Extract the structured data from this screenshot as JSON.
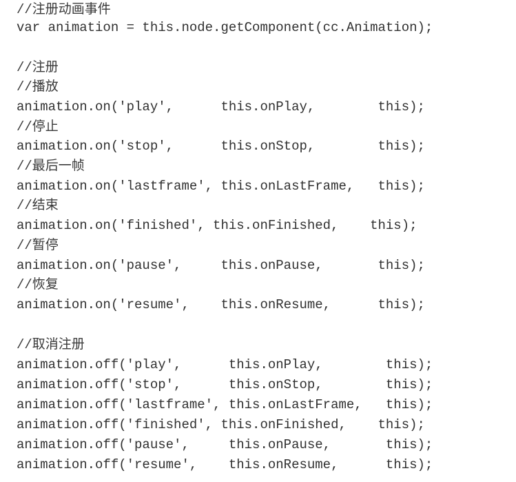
{
  "code": {
    "lines": [
      "//注册动画事件",
      "var animation = this.node.getComponent(cc.Animation);",
      "",
      "//注册",
      "//播放",
      "animation.on('play',      this.onPlay,        this);",
      "//停止",
      "animation.on('stop',      this.onStop,        this);",
      "//最后一帧",
      "animation.on('lastframe', this.onLastFrame,   this);",
      "//结束",
      "animation.on('finished', this.onFinished,    this);",
      "//暂停",
      "animation.on('pause',     this.onPause,       this);",
      "//恢复",
      "animation.on('resume',    this.onResume,      this);",
      "",
      "//取消注册",
      "animation.off('play',      this.onPlay,        this);",
      "animation.off('stop',      this.onStop,        this);",
      "animation.off('lastframe', this.onLastFrame,   this);",
      "animation.off('finished', this.onFinished,    this);",
      "animation.off('pause',     this.onPause,       this);",
      "animation.off('resume',    this.onResume,      this);"
    ]
  }
}
